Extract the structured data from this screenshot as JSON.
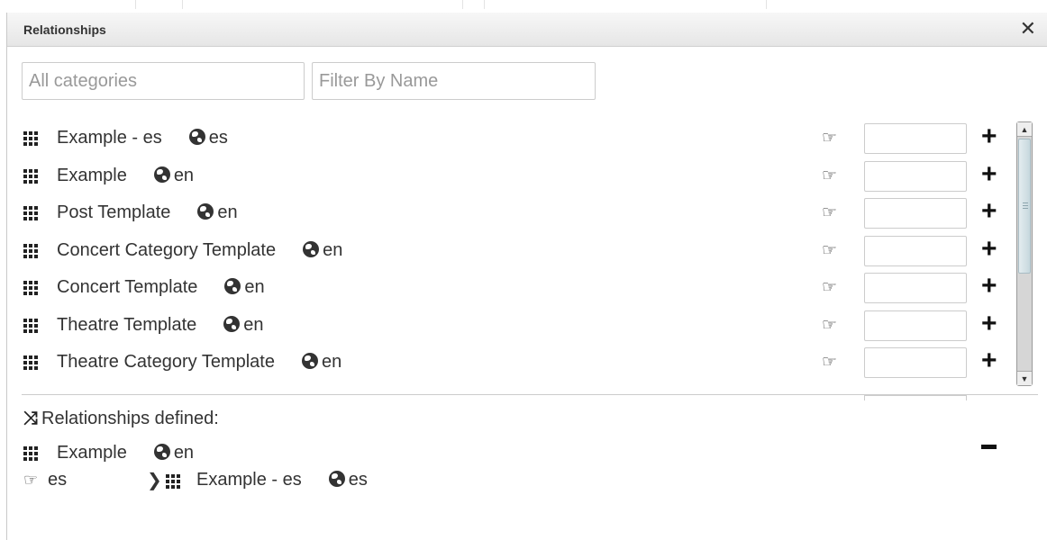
{
  "dialog": {
    "title": "Relationships",
    "close_label": "✕"
  },
  "filters": {
    "category_placeholder": "All categories",
    "name_placeholder": "Filter By Name"
  },
  "items": [
    {
      "name": "Example - es",
      "lang": "es"
    },
    {
      "name": "Example",
      "lang": "en"
    },
    {
      "name": "Post Template",
      "lang": "en"
    },
    {
      "name": "Concert Category Template",
      "lang": "en"
    },
    {
      "name": "Concert Template",
      "lang": "en"
    },
    {
      "name": "Theatre Template",
      "lang": "en"
    },
    {
      "name": "Theatre Category Template",
      "lang": "en"
    }
  ],
  "row_icons": {
    "hand": "☞",
    "plus": "+",
    "globe": "globe-icon",
    "grid": "th-icon"
  },
  "relationships_defined": {
    "header": "Relationships defined:",
    "source": {
      "name": "Example",
      "lang": "en"
    },
    "relation_lang": "es",
    "target": {
      "name": "Example - es",
      "lang": "es"
    }
  }
}
